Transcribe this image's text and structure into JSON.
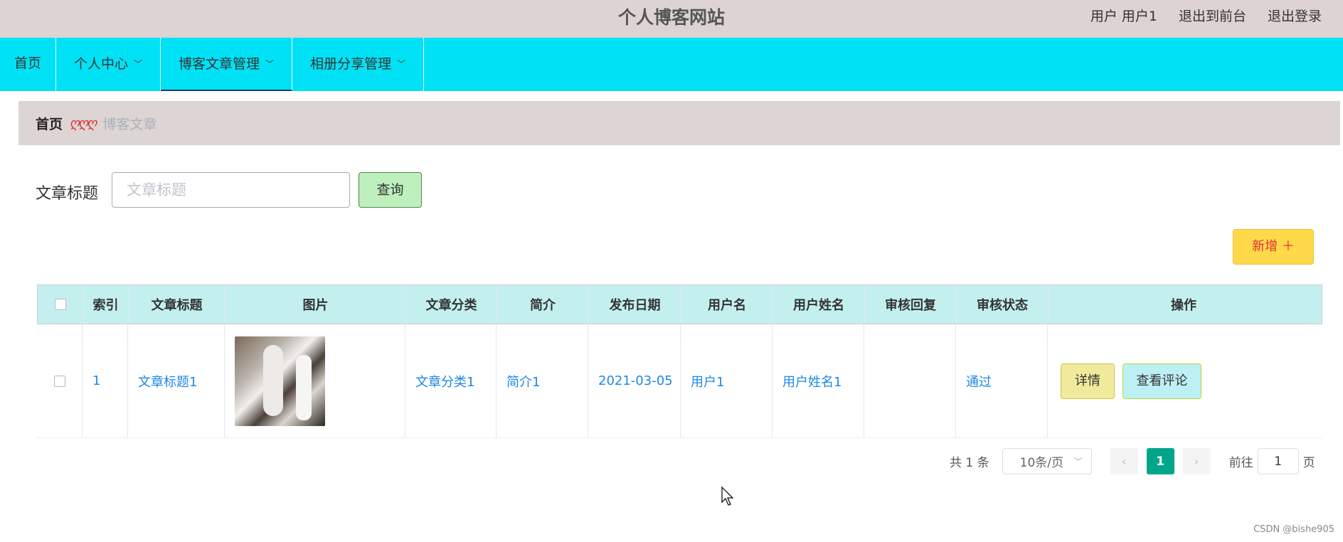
{
  "header": {
    "site_title": "个人博客网站",
    "user_label": "用户 用户1",
    "to_front_label": "退出到前台",
    "logout_label": "退出登录"
  },
  "nav": {
    "items": [
      {
        "label": "首页",
        "has_dropdown": false
      },
      {
        "label": "个人中心",
        "has_dropdown": true
      },
      {
        "label": "博客文章管理",
        "has_dropdown": true,
        "active": true
      },
      {
        "label": "相册分享管理",
        "has_dropdown": true
      }
    ]
  },
  "breadcrumb": {
    "home": "首页",
    "separator": "ღღღ",
    "current": "博客文章"
  },
  "search": {
    "label": "文章标题",
    "placeholder": "文章标题",
    "value": "",
    "query_label": "查询"
  },
  "add_button_label": "新增 ＋",
  "table": {
    "columns": [
      "",
      "索引",
      "文章标题",
      "图片",
      "文章分类",
      "简介",
      "发布日期",
      "用户名",
      "用户姓名",
      "审核回复",
      "审核状态",
      "操作"
    ],
    "rows": [
      {
        "index": "1",
        "title": "文章标题1",
        "category": "文章分类1",
        "intro": "简介1",
        "date": "2021-03-05",
        "username": "用户1",
        "realname": "用户姓名1",
        "reply": "",
        "status": "通过",
        "detail_label": "详情",
        "comment_label": "查看评论"
      }
    ]
  },
  "pagination": {
    "total_text": "共 1 条",
    "page_size": "10条/页",
    "prev": "‹",
    "current_page": "1",
    "next": "›",
    "goto_label": "前往",
    "goto_value": "1",
    "page_suffix": "页"
  },
  "watermark": "CSDN @bishe905",
  "colors": {
    "topbar": "#ddd3d2",
    "navbar": "#00e1f5",
    "table_header": "#c3f0ef",
    "query_button": "#bdf0bc",
    "add_button": "#ffd94a",
    "active_page": "#00a58a",
    "link": "#1e88e5"
  }
}
